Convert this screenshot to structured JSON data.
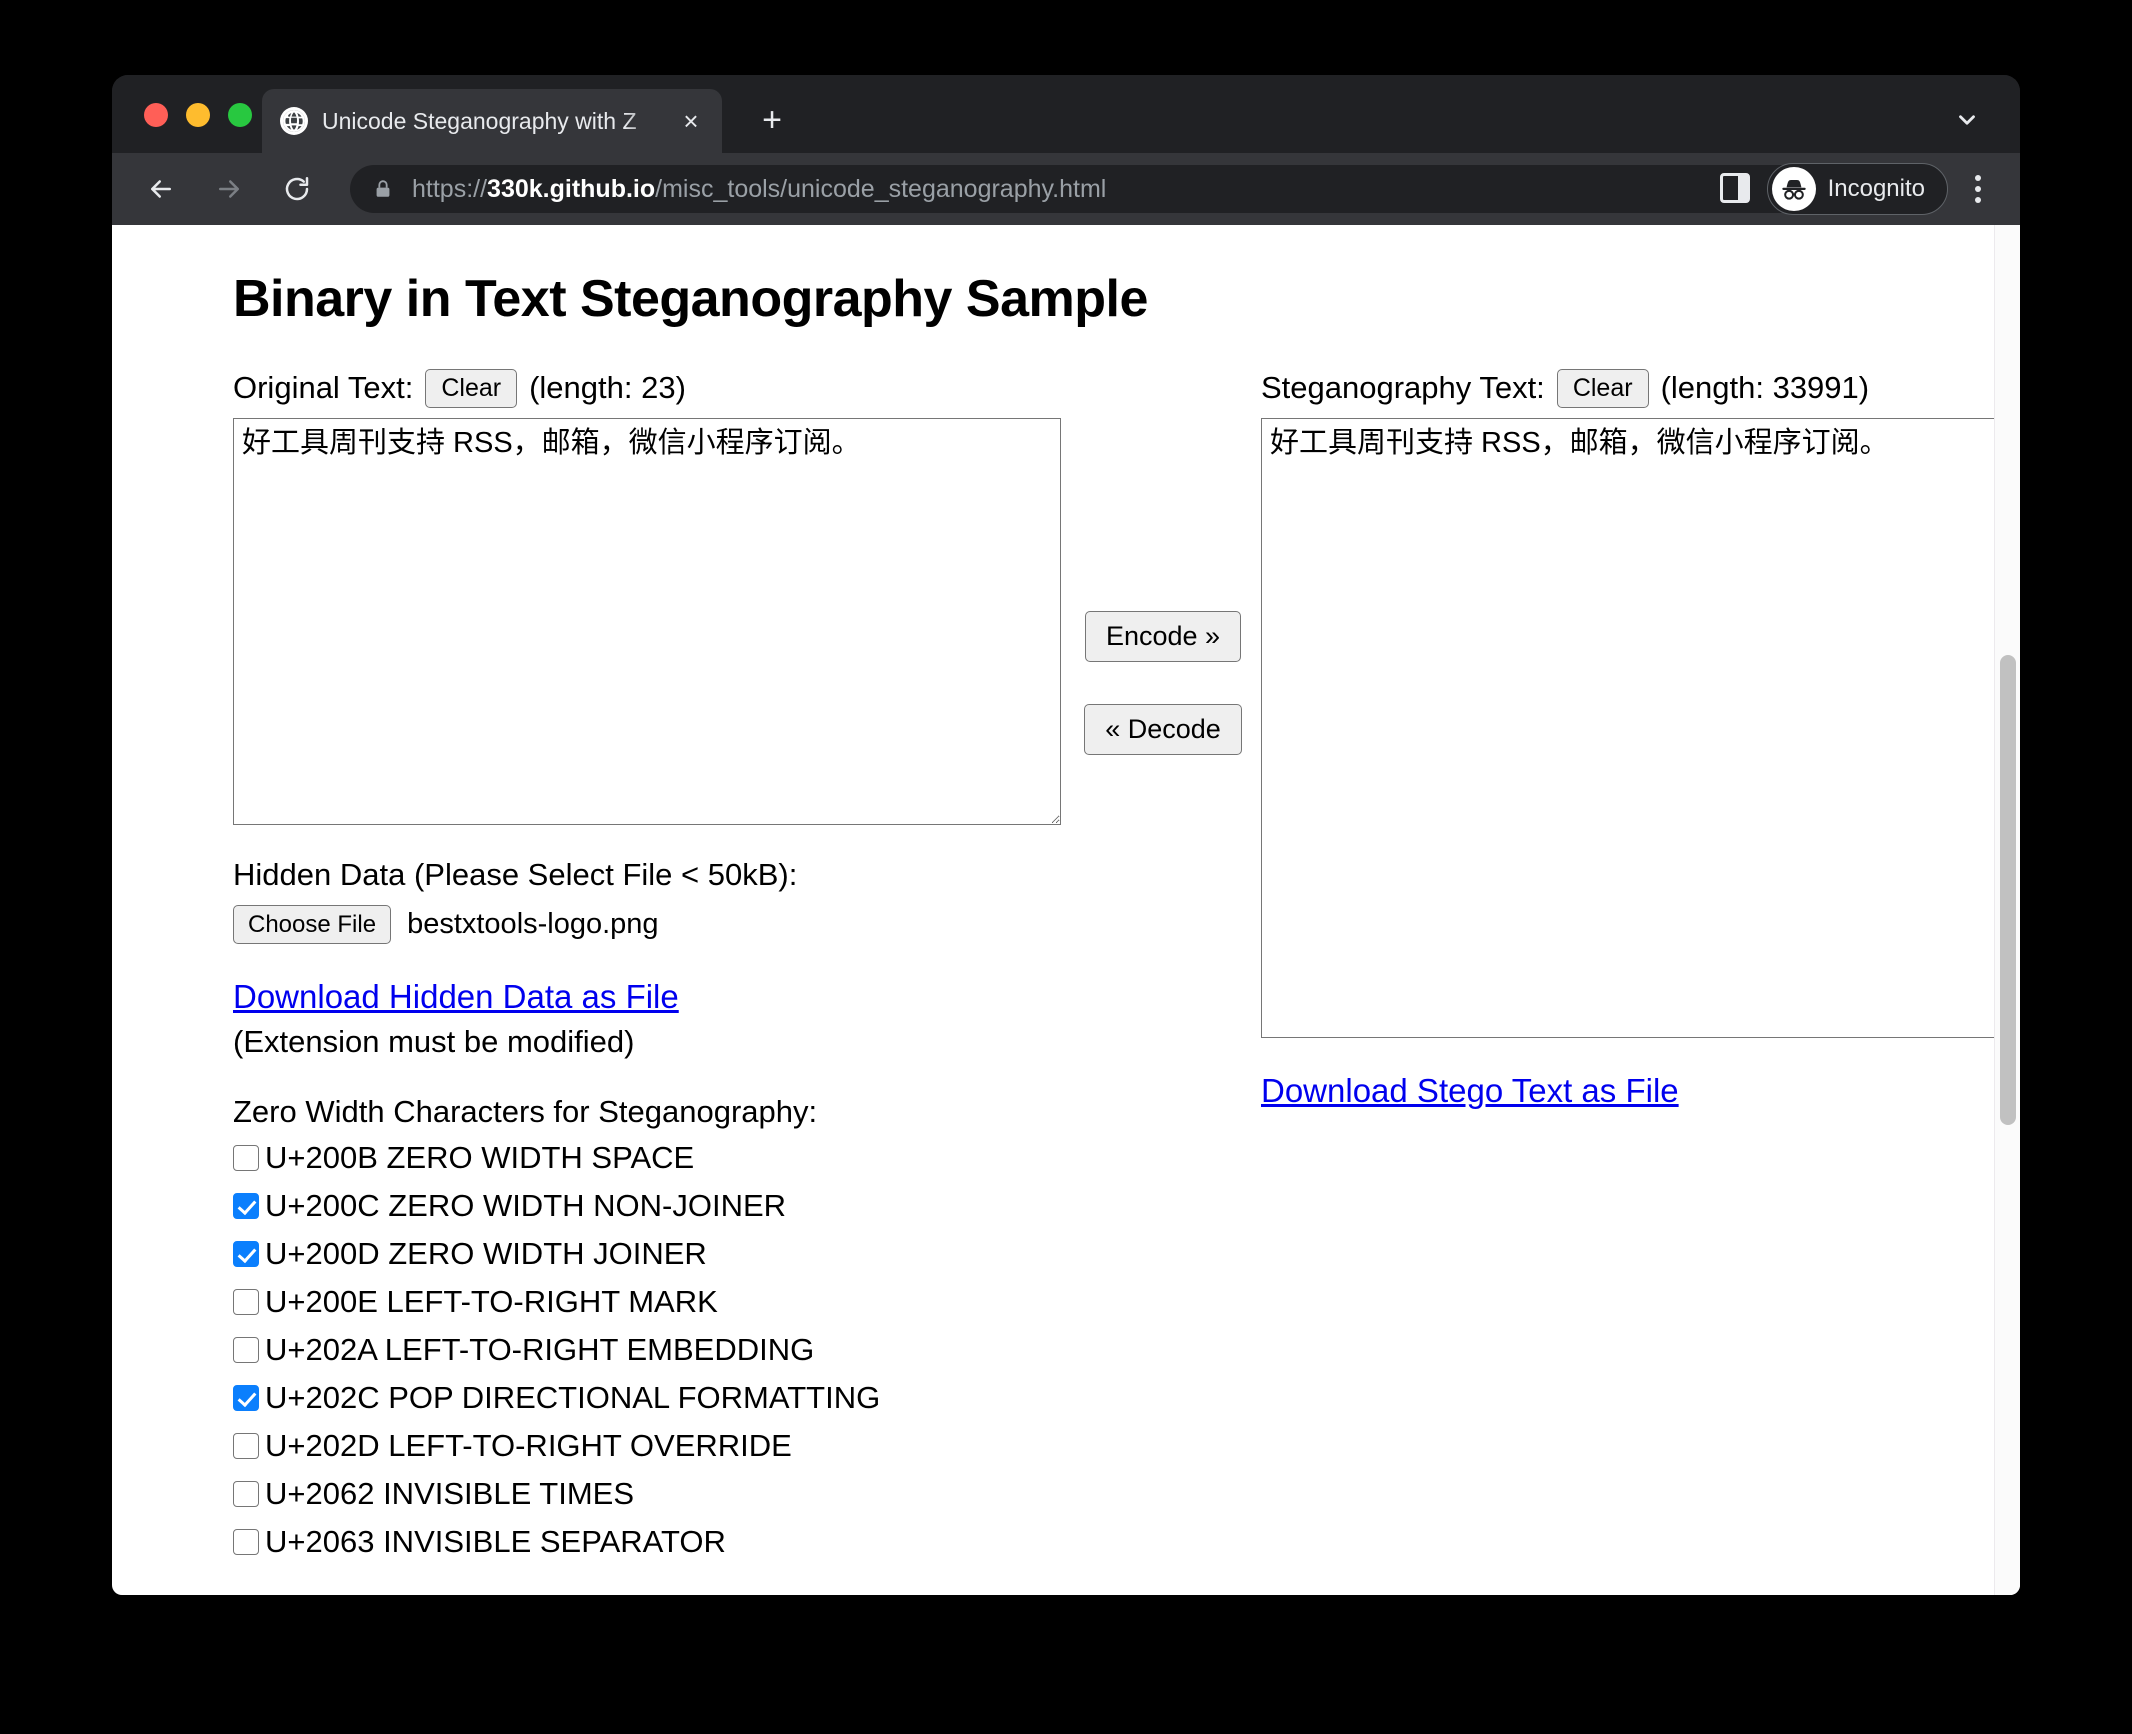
{
  "browser": {
    "tab": {
      "title": "Unicode Steganography with Z",
      "favicon": "globe-icon",
      "close_label": "×"
    },
    "new_tab_label": "+",
    "toolbar": {
      "back_icon": "arrow-left-icon",
      "forward_icon": "arrow-right-icon",
      "reload_icon": "reload-icon",
      "lock_icon": "lock-icon",
      "url_scheme": "https://",
      "url_host": "330k.github.io",
      "url_path": "/misc_tools/unicode_steganography.html",
      "star_icon": "star-icon",
      "sidebar_icon": "sidebar-panel-icon",
      "incognito_label": "Incognito",
      "incognito_icon": "incognito-hat-glasses-icon",
      "menu_icon": "three-dots-menu-icon"
    },
    "tab_list_icon": "chevron-down-icon"
  },
  "page": {
    "heading": "Binary in Text Steganography Sample",
    "original": {
      "label": "Original Text:",
      "clear_label": "Clear",
      "length_text": "(length: 23)",
      "value": "好工具周刊支持 RSS，邮箱，微信小程序订阅。"
    },
    "stego": {
      "label": "Steganography Text:",
      "clear_label": "Clear",
      "length_text": "(length: 33991)",
      "value": "好工具周刊支持 RSS，邮箱，微信小程序订阅。",
      "download_link": "Download Stego Text as File"
    },
    "encode_button": "Encode »",
    "decode_button": "« Decode",
    "hidden_data": {
      "label": "Hidden Data (Please Select File < 50kB):",
      "choose_file_label": "Choose File",
      "file_name": "bestxtools-logo.png",
      "download_link": "Download Hidden Data as File",
      "note": "(Extension must be modified)"
    },
    "zero_width": {
      "heading": "Zero Width Characters for Steganography:",
      "items": [
        {
          "label": "U+200B ZERO WIDTH SPACE",
          "checked": false
        },
        {
          "label": "U+200C ZERO WIDTH NON-JOINER",
          "checked": true
        },
        {
          "label": "U+200D ZERO WIDTH JOINER",
          "checked": true
        },
        {
          "label": "U+200E LEFT-TO-RIGHT MARK",
          "checked": false
        },
        {
          "label": "U+202A LEFT-TO-RIGHT EMBEDDING",
          "checked": false
        },
        {
          "label": "U+202C POP DIRECTIONAL FORMATTING",
          "checked": true
        },
        {
          "label": "U+202D LEFT-TO-RIGHT OVERRIDE",
          "checked": false
        },
        {
          "label": "U+2062 INVISIBLE TIMES",
          "checked": false
        },
        {
          "label": "U+2063 INVISIBLE SEPARATOR",
          "checked": false
        }
      ]
    }
  },
  "colors": {
    "chrome_dark": "#202124",
    "chrome_toolbar": "#35363a",
    "link_blue": "#0000EE",
    "checkbox_blue": "#0B7FFD",
    "traffic_red": "#FF5F57",
    "traffic_yellow": "#FEBC2E",
    "traffic_green": "#28C840"
  }
}
